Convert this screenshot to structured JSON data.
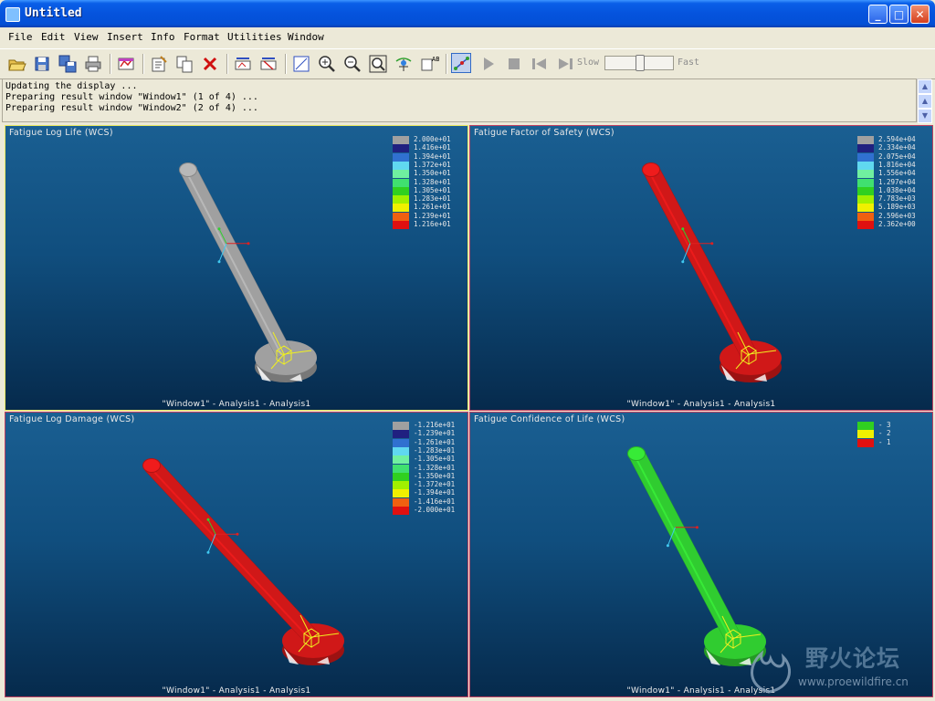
{
  "window": {
    "title": "Untitled"
  },
  "menu": [
    "File",
    "Edit",
    "View",
    "Insert",
    "Info",
    "Format",
    "Utilities",
    "Window"
  ],
  "toolbar": {
    "buttons": [
      "open-icon",
      "save-icon",
      "save-copy-icon",
      "print-icon",
      "result-window-icon",
      "edit-definition-icon",
      "copy-icon",
      "delete-icon",
      "show-icon",
      "hide-icon",
      "view-options-icon",
      "zoom-in-icon",
      "zoom-out-icon",
      "zoom-fit-icon",
      "reorient-icon",
      "legend-icon",
      "animate-icon",
      "play-icon",
      "stop-icon",
      "first-frame-icon",
      "last-frame-icon"
    ],
    "slow_label": "Slow",
    "fast_label": "Fast",
    "speed": 0.5
  },
  "messages": [
    "Updating the display ...",
    "Preparing result window \"Window1\" (1 of 4) ...",
    "Preparing result window \"Window2\" (2 of 4) ..."
  ],
  "viewports": [
    {
      "title": "Fatigue Log Life (WCS)",
      "footer": "\"Window1\" - Analysis1 - Analysis1",
      "model_color": "#a0a0a0",
      "legend": [
        {
          "color": "#a0a0a0",
          "label": "2.000e+01"
        },
        {
          "color": "#202080",
          "label": "1.416e+01"
        },
        {
          "color": "#3070d0",
          "label": "1.394e+01"
        },
        {
          "color": "#60d8f0",
          "label": "1.372e+01"
        },
        {
          "color": "#70f0a0",
          "label": "1.350e+01"
        },
        {
          "color": "#40e070",
          "label": "1.328e+01"
        },
        {
          "color": "#30d020",
          "label": "1.305e+01"
        },
        {
          "color": "#a0f000",
          "label": "1.283e+01"
        },
        {
          "color": "#f0f000",
          "label": "1.261e+01"
        },
        {
          "color": "#f06010",
          "label": "1.239e+01"
        },
        {
          "color": "#e01010",
          "label": "1.216e+01"
        }
      ]
    },
    {
      "title": "Fatigue Factor of Safety (WCS)",
      "footer": "\"Window1\" - Analysis1 - Analysis1",
      "model_color": "#d01818",
      "legend": [
        {
          "color": "#a0a0a0",
          "label": "2.594e+04"
        },
        {
          "color": "#202080",
          "label": "2.334e+04"
        },
        {
          "color": "#3070d0",
          "label": "2.075e+04"
        },
        {
          "color": "#60d8f0",
          "label": "1.816e+04"
        },
        {
          "color": "#70f0a0",
          "label": "1.556e+04"
        },
        {
          "color": "#40e070",
          "label": "1.297e+04"
        },
        {
          "color": "#30d020",
          "label": "1.038e+04"
        },
        {
          "color": "#a0f000",
          "label": "7.783e+03"
        },
        {
          "color": "#f0f000",
          "label": "5.189e+03"
        },
        {
          "color": "#f06010",
          "label": "2.596e+03"
        },
        {
          "color": "#e01010",
          "label": "2.362e+00"
        }
      ]
    },
    {
      "title": "Fatigue Log Damage (WCS)",
      "footer": "\"Window1\" - Analysis1 - Analysis1",
      "model_color": "#d01818",
      "legend": [
        {
          "color": "#a0a0a0",
          "label": "-1.216e+01"
        },
        {
          "color": "#202080",
          "label": "-1.239e+01"
        },
        {
          "color": "#3070d0",
          "label": "-1.261e+01"
        },
        {
          "color": "#60d8f0",
          "label": "-1.283e+01"
        },
        {
          "color": "#70f0a0",
          "label": "-1.305e+01"
        },
        {
          "color": "#40e070",
          "label": "-1.328e+01"
        },
        {
          "color": "#30d020",
          "label": "-1.350e+01"
        },
        {
          "color": "#a0f000",
          "label": "-1.372e+01"
        },
        {
          "color": "#f0f000",
          "label": "-1.394e+01"
        },
        {
          "color": "#f06010",
          "label": "-1.416e+01"
        },
        {
          "color": "#e01010",
          "label": "-2.000e+01"
        }
      ]
    },
    {
      "title": "Fatigue Confidence of Life (WCS)",
      "footer": "\"Window1\" - Analysis1 - Analysis1",
      "model_color": "#30cc30",
      "legend": [
        {
          "color": "#30d020",
          "label": "- 3"
        },
        {
          "color": "#f0f000",
          "label": "- 2"
        },
        {
          "color": "#e01010",
          "label": "- 1"
        }
      ]
    }
  ],
  "watermark": {
    "text": "野火论坛",
    "url": "www.proewildfire.cn"
  }
}
